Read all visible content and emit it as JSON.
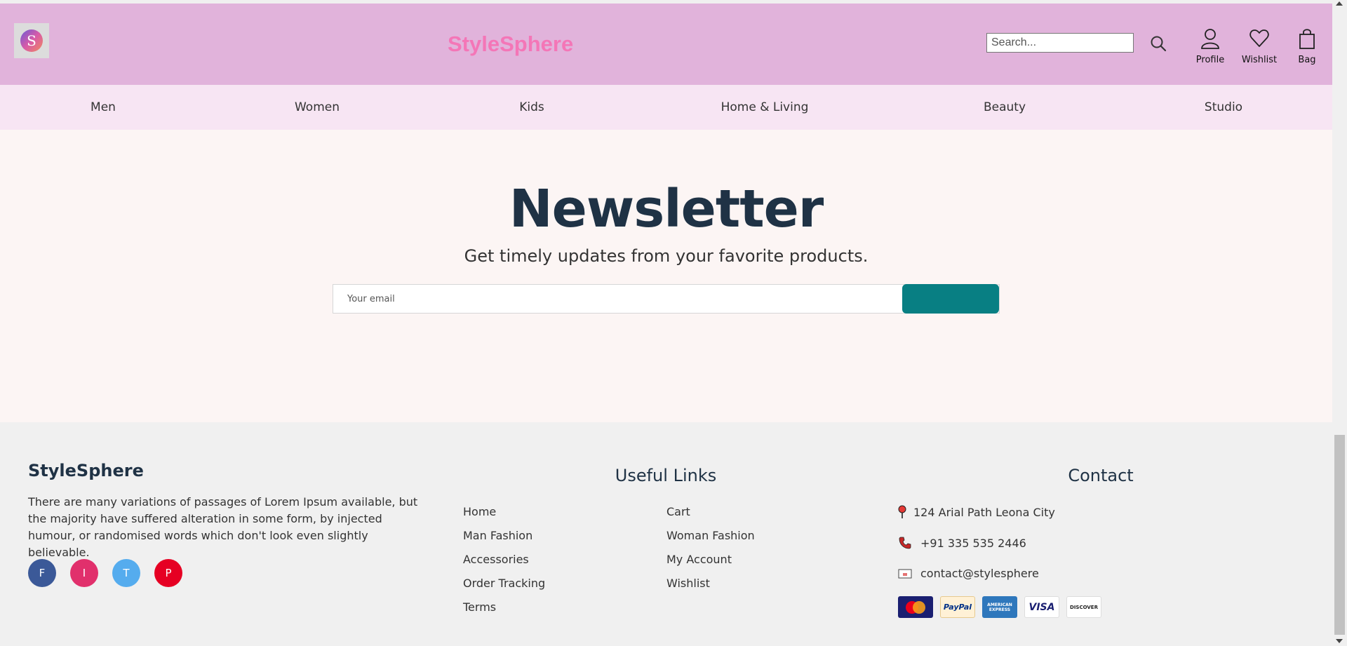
{
  "header": {
    "logo_letter": "S",
    "brand": "StyleSphere",
    "search_placeholder": "Search...",
    "icons": [
      {
        "name": "profile-icon",
        "label": "Profile"
      },
      {
        "name": "wishlist-icon",
        "label": "Wishlist"
      },
      {
        "name": "bag-icon",
        "label": "Bag"
      }
    ],
    "colors": {
      "bar": "#e1b3db",
      "brand": "#f476b7"
    }
  },
  "nav": {
    "items": [
      "Men",
      "Women",
      "Kids",
      "Home & Living",
      "Beauty",
      "Studio"
    ],
    "background": "#f7e5f3"
  },
  "newsletter": {
    "title": "Newsletter",
    "subtitle": "Get timely updates from your favorite products.",
    "email_placeholder": "Your email",
    "button_color": "#087f83"
  },
  "footer": {
    "brand": "StyleSphere",
    "description": "There are many variations of passages of Lorem Ipsum available, but the majority have suffered alteration in some form, by injected humour, or randomised words which don't look even slightly believable.",
    "social": [
      {
        "letter": "F",
        "color": "#3b5998"
      },
      {
        "letter": "I",
        "color": "#e1306c"
      },
      {
        "letter": "T",
        "color": "#55acee"
      },
      {
        "letter": "P",
        "color": "#e60023"
      }
    ],
    "useful_links_title": "Useful Links",
    "links_col1": [
      "Home",
      "Man Fashion",
      "Accessories",
      "Order Tracking",
      "Terms"
    ],
    "links_col2": [
      "Cart",
      "Woman Fashion",
      "My Account",
      "Wishlist"
    ],
    "contact_title": "Contact",
    "address": "124 Arial Path Leona City",
    "phone": "+91 335 535 2446",
    "email": "contact@stylesphere",
    "payment_cards": [
      "MasterCard",
      "PayPal",
      "AMERICAN EXPRESS",
      "VISA",
      "DISCOVER"
    ]
  }
}
